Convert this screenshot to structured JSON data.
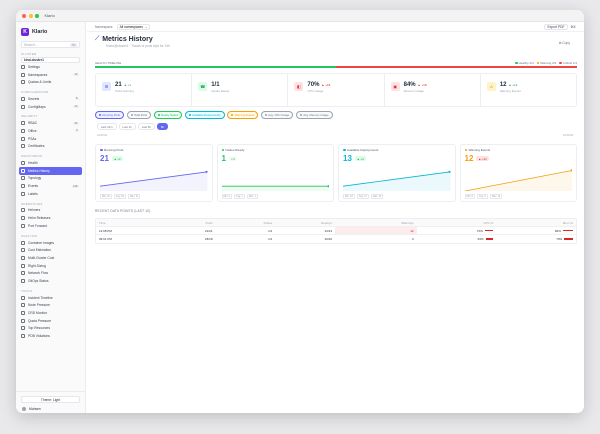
{
  "window": {
    "title": "Klario"
  },
  "sidebar": {
    "brand": "Klario",
    "search_placeholder": "Search...",
    "search_shortcut": "⌘K",
    "sections": [
      {
        "title": "CLUSTER",
        "items": [],
        "cluster": "kind-cluster1"
      },
      {
        "title": "",
        "items": [
          {
            "label": "Settings"
          },
          {
            "label": "Namespaces",
            "count": "12"
          },
          {
            "label": "Quotas & Limits"
          }
        ]
      },
      {
        "title": "CONFIGURATION",
        "items": [
          {
            "label": "Secrets",
            "count": "8"
          },
          {
            "label": "ConfigMaps",
            "count": "14"
          }
        ]
      },
      {
        "title": "SECURITY",
        "items": [
          {
            "label": "RBAC",
            "count": "32"
          },
          {
            "label": "Office",
            "count": "3"
          },
          {
            "label": "PSAs"
          },
          {
            "label": "Certificates"
          }
        ]
      },
      {
        "title": "MONITORING",
        "items": [
          {
            "label": "Health"
          },
          {
            "label": "Metrics History",
            "active": true
          },
          {
            "label": "Topology"
          },
          {
            "label": "Events",
            "count": "128"
          },
          {
            "label": "Labels"
          }
        ]
      },
      {
        "title": "OPERATIONS",
        "items": [
          {
            "label": "Helmers"
          },
          {
            "label": "Helm Releases"
          },
          {
            "label": "Port Forward"
          }
        ]
      },
      {
        "title": "ANALYSIS",
        "items": [
          {
            "label": "Container Images"
          },
          {
            "label": "Cost Estimation"
          },
          {
            "label": "Multi-Cluster Cost"
          },
          {
            "label": "Right-Sizing"
          },
          {
            "label": "Network Flow"
          },
          {
            "label": "GitOps Status"
          }
        ]
      },
      {
        "title": "TOOLS",
        "items": [
          {
            "label": "Incident Timeline"
          },
          {
            "label": "Node Pressure"
          },
          {
            "label": "CRD Monitor"
          },
          {
            "label": "Quota Pressure"
          },
          {
            "label": "Top Resources"
          },
          {
            "label": "PDB Violations"
          }
        ]
      }
    ],
    "theme_label": "Theme: Light",
    "user_name": "Mohsen"
  },
  "topbar": {
    "breadcrumb": "Namespace",
    "namespace": "All namespaces",
    "export_label": "Export PDF",
    "shortcut": "⌘K"
  },
  "page": {
    "title": "Metrics History",
    "subtitle": "Klario@cluster1 · Tracks of pods kept for 24h",
    "copy_label": "Copy"
  },
  "health": {
    "label": "HEALTH TIMELINE",
    "legend": [
      "Healthy 4/4",
      "Warning 0/4",
      "Critical 1/4"
    ],
    "healthy_fraction": 0.5,
    "critical_fraction": 0.5
  },
  "kpis": [
    {
      "value": "21",
      "delta": "▲ +1",
      "label": "Pods Running",
      "icon": "⊞",
      "bg": "#e0e7ff",
      "fg": "#4f46e5",
      "dc": "#16a34a"
    },
    {
      "value": "1/1",
      "delta": "",
      "label": "Nodes Ready",
      "icon": "☎",
      "bg": "#dcfce7",
      "fg": "#16a34a",
      "dc": "#16a34a"
    },
    {
      "value": "70%",
      "delta": "▲ +18",
      "label": "CPU Usage",
      "icon": "◧",
      "bg": "#fee2e2",
      "fg": "#dc2626",
      "dc": "#dc2626"
    },
    {
      "value": "84%",
      "delta": "▲ +18",
      "label": "Memory Usage",
      "icon": "▣",
      "bg": "#fee2e2",
      "fg": "#dc2626",
      "dc": "#dc2626"
    },
    {
      "value": "12",
      "delta": "▲ +12",
      "label": "Warning Events",
      "icon": "⚠",
      "bg": "#fef3c7",
      "fg": "#d97706",
      "dc": "#16a34a"
    }
  ],
  "chips": [
    {
      "label": "Running Pods",
      "color": "#6366f1",
      "bg": "#eef2ff"
    },
    {
      "label": "Total Pods",
      "color": "#9ca3af",
      "bg": "#f9fafb"
    },
    {
      "label": "Ready Nodes",
      "color": "#22c55e",
      "bg": "#f0fdf4"
    },
    {
      "label": "Available Deployments",
      "color": "#06b6d4",
      "bg": "#ecfeff"
    },
    {
      "label": "Warning Events",
      "color": "#f59e0b",
      "bg": "#fffbeb"
    },
    {
      "label": "Avg. CPU Usage",
      "color": "#9ca3af",
      "bg": "#f9fafb"
    },
    {
      "label": "Avg. Memory Usage",
      "color": "#9ca3af",
      "bg": "#f9fafb"
    }
  ],
  "ranges": [
    {
      "label": "Last 15m"
    },
    {
      "label": "Last 1h"
    },
    {
      "label": "Last 6h"
    },
    {
      "label": "6h",
      "on": true
    }
  ],
  "timestamps": [
    "12:03:04",
    "12:03:04"
  ],
  "cards": [
    {
      "title": "Running Pods",
      "value": "21",
      "badge": "▲ +1",
      "color": "#6366f1",
      "badge_bg": "#dcfce7",
      "badge_fg": "#16a34a",
      "tags": [
        "Min: 20",
        "Avg: 20",
        "Max: 21"
      ],
      "values": [
        18,
        18.6,
        19.2,
        19.8,
        20.4,
        21
      ],
      "ymin": 17,
      "ymax": 22
    },
    {
      "title": "Nodes Ready",
      "value": "1",
      "badge": "= 0",
      "color": "#22c55e",
      "badge_bg": "#f0fdf4",
      "badge_fg": "#16a34a",
      "tags": [
        "Min: 1",
        "Avg: 1",
        "Max: 1"
      ],
      "values": [
        1,
        1,
        1,
        1,
        1,
        1
      ],
      "ymin": 0,
      "ymax": 5
    },
    {
      "title": "Available Deployments",
      "value": "13",
      "badge": "▲ +3",
      "color": "#06b6d4",
      "badge_bg": "#dcfce7",
      "badge_fg": "#16a34a",
      "tags": [
        "Min: 10",
        "Avg: 11",
        "Max: 13"
      ],
      "values": [
        10,
        10.6,
        11.2,
        11.8,
        12.4,
        13
      ],
      "ymin": 9,
      "ymax": 14
    },
    {
      "title": "Warning Events",
      "value": "12",
      "badge": "▲ +12",
      "color": "#f59e0b",
      "badge_bg": "#fee2e2",
      "badge_fg": "#dc2626",
      "tags": [
        "Min: 0",
        "Avg: 6",
        "Max: 12"
      ],
      "values": [
        0,
        2.4,
        4.8,
        7.2,
        9.6,
        12
      ],
      "ymin": 0,
      "ymax": 14
    }
  ],
  "table": {
    "title": "RECENT DATA POINTS (LAST 10)",
    "headers": [
      "Time",
      "Pods",
      "Nodes",
      "Deploys",
      "Warnings",
      "CPU %",
      "Mem %"
    ],
    "rows": [
      [
        "12:08 PM",
        "21/21",
        "1/1",
        "13/13",
        "12",
        "70%",
        "84%"
      ],
      [
        "09:01 PM",
        "18/18",
        "1/1",
        "10/10",
        "0",
        "64%",
        "73%"
      ]
    ]
  }
}
